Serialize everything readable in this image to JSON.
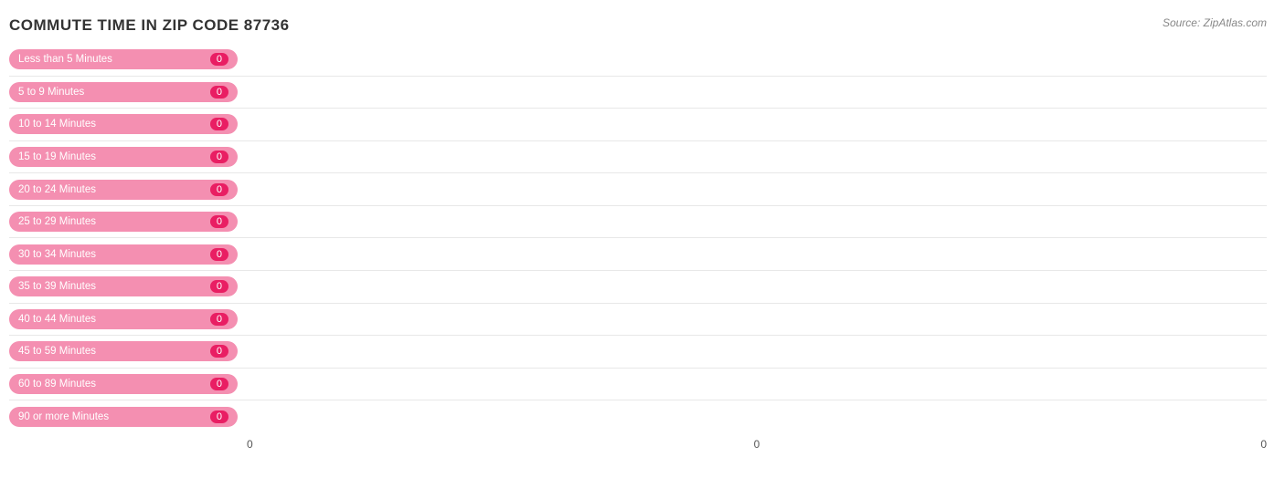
{
  "title": "COMMUTE TIME IN ZIP CODE 87736",
  "source": "Source: ZipAtlas.com",
  "bars": [
    {
      "label": "Less than 5 Minutes",
      "value": 0
    },
    {
      "label": "5 to 9 Minutes",
      "value": 0
    },
    {
      "label": "10 to 14 Minutes",
      "value": 0
    },
    {
      "label": "15 to 19 Minutes",
      "value": 0
    },
    {
      "label": "20 to 24 Minutes",
      "value": 0
    },
    {
      "label": "25 to 29 Minutes",
      "value": 0
    },
    {
      "label": "30 to 34 Minutes",
      "value": 0
    },
    {
      "label": "35 to 39 Minutes",
      "value": 0
    },
    {
      "label": "40 to 44 Minutes",
      "value": 0
    },
    {
      "label": "45 to 59 Minutes",
      "value": 0
    },
    {
      "label": "60 to 89 Minutes",
      "value": 0
    },
    {
      "label": "90 or more Minutes",
      "value": 0
    }
  ],
  "xAxis": {
    "ticks": [
      "0",
      "0",
      "0"
    ]
  },
  "colors": {
    "labelBg": "#f48fb1",
    "valueBg": "#e91e63",
    "barFill": "#f48fb1"
  }
}
